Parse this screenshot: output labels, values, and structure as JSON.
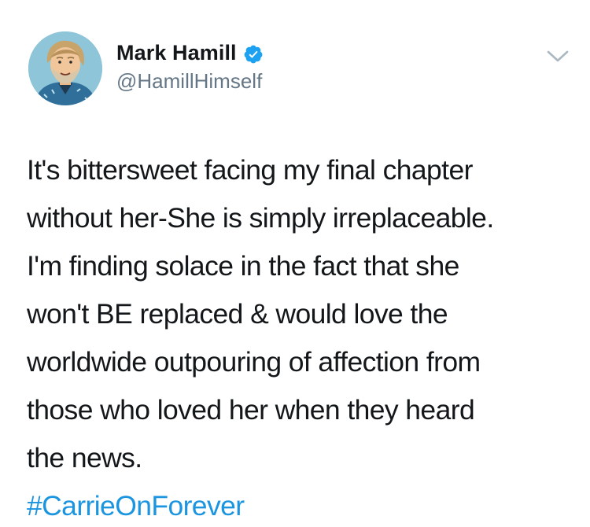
{
  "user": {
    "display_name": "Mark Hamill",
    "handle": "@HamillHimself",
    "verified": true,
    "avatar_icon": "illustrated-portrait-avatar"
  },
  "tweet": {
    "lines": [
      "It's bittersweet facing my final chapter",
      "without her-She is simply irreplaceable.",
      "I'm finding solace in the fact that she",
      "won't BE replaced & would love the",
      "worldwide outpouring of affection from",
      "those who loved her when they heard",
      "the news."
    ],
    "hashtag": "#CarrieOnForever"
  },
  "colors": {
    "text": "#14171a",
    "secondary": "#657786",
    "link": "#1b95e0",
    "verified_badge": "#1da1f2",
    "caret": "#aab8c2"
  },
  "icons": {
    "verified": "verified-badge-icon",
    "menu": "chevron-down-icon"
  }
}
